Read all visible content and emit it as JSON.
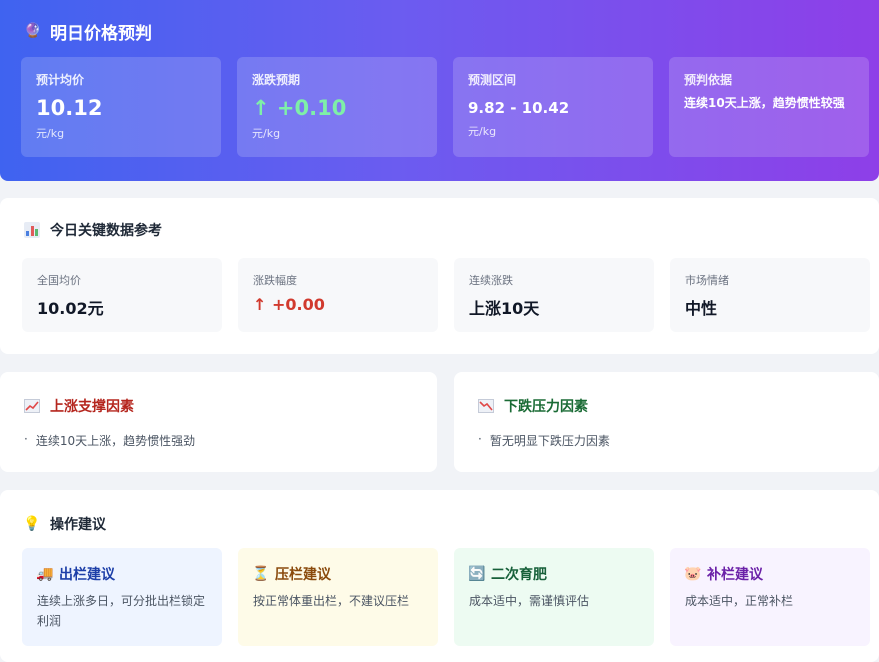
{
  "hero": {
    "title": "明日价格预判",
    "icon": "fortune-teller-icon",
    "cards": [
      {
        "label": "预计均价",
        "value": "10.12",
        "unit": "元/kg"
      },
      {
        "label": "涨跌预期",
        "value": "↑ +0.10",
        "unit": "元/kg"
      },
      {
        "label": "预测区间",
        "value": "9.82 - 10.42",
        "unit": "元/kg"
      },
      {
        "label": "预判依据",
        "value": "连续10天上涨，趋势惯性较强"
      }
    ]
  },
  "today": {
    "title": "今日关键数据参考",
    "icon": "bar-chart-icon",
    "stats": [
      {
        "label": "全国均价",
        "value": "10.02元"
      },
      {
        "label": "涨跌幅度",
        "value": "↑ +0.00"
      },
      {
        "label": "连续涨跌",
        "value": "上涨10天"
      },
      {
        "label": "市场情绪",
        "value": "中性"
      }
    ]
  },
  "up_factors": {
    "title": "上涨支撑因素",
    "icon": "chart-increasing-icon",
    "items": [
      "连续10天上涨，趋势惯性强劲"
    ]
  },
  "down_factors": {
    "title": "下跌压力因素",
    "icon": "chart-decreasing-icon",
    "items": [
      "暂无明显下跌压力因素"
    ]
  },
  "advice": {
    "title": "操作建议",
    "icon": "light-bulb-icon",
    "cards": [
      {
        "title": "出栏建议",
        "icon": "truck-icon",
        "body": "连续上涨多日，可分批出栏锁定利润"
      },
      {
        "title": "压栏建议",
        "icon": "hourglass-icon",
        "body": "按正常体重出栏，不建议压栏"
      },
      {
        "title": "二次育肥",
        "icon": "refresh-icon",
        "body": "成本适中，需谨慎评估"
      },
      {
        "title": "补栏建议",
        "icon": "pig-icon",
        "body": "成本适中，正常补栏"
      }
    ]
  },
  "colors": {
    "hero_start": "#3f63f0",
    "hero_end": "#8e3fe8",
    "up_green": "#7ef0a8",
    "up_red": "#d13a2e",
    "factor_red": "#b5261e",
    "factor_green": "#1a6b35"
  }
}
